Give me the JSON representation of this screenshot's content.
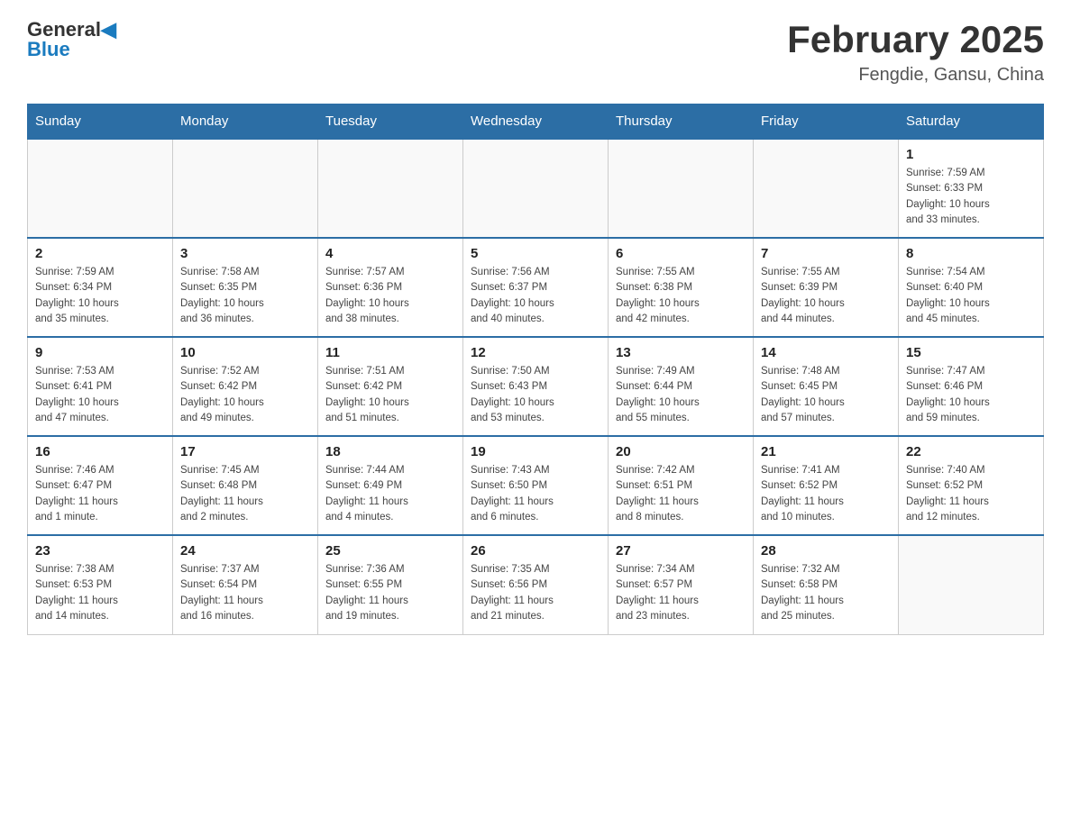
{
  "header": {
    "logo_general": "General",
    "logo_blue": "Blue",
    "month_title": "February 2025",
    "location": "Fengdie, Gansu, China"
  },
  "days_of_week": [
    "Sunday",
    "Monday",
    "Tuesday",
    "Wednesday",
    "Thursday",
    "Friday",
    "Saturday"
  ],
  "weeks": [
    {
      "days": [
        {
          "num": "",
          "info": ""
        },
        {
          "num": "",
          "info": ""
        },
        {
          "num": "",
          "info": ""
        },
        {
          "num": "",
          "info": ""
        },
        {
          "num": "",
          "info": ""
        },
        {
          "num": "",
          "info": ""
        },
        {
          "num": "1",
          "info": "Sunrise: 7:59 AM\nSunset: 6:33 PM\nDaylight: 10 hours\nand 33 minutes."
        }
      ]
    },
    {
      "days": [
        {
          "num": "2",
          "info": "Sunrise: 7:59 AM\nSunset: 6:34 PM\nDaylight: 10 hours\nand 35 minutes."
        },
        {
          "num": "3",
          "info": "Sunrise: 7:58 AM\nSunset: 6:35 PM\nDaylight: 10 hours\nand 36 minutes."
        },
        {
          "num": "4",
          "info": "Sunrise: 7:57 AM\nSunset: 6:36 PM\nDaylight: 10 hours\nand 38 minutes."
        },
        {
          "num": "5",
          "info": "Sunrise: 7:56 AM\nSunset: 6:37 PM\nDaylight: 10 hours\nand 40 minutes."
        },
        {
          "num": "6",
          "info": "Sunrise: 7:55 AM\nSunset: 6:38 PM\nDaylight: 10 hours\nand 42 minutes."
        },
        {
          "num": "7",
          "info": "Sunrise: 7:55 AM\nSunset: 6:39 PM\nDaylight: 10 hours\nand 44 minutes."
        },
        {
          "num": "8",
          "info": "Sunrise: 7:54 AM\nSunset: 6:40 PM\nDaylight: 10 hours\nand 45 minutes."
        }
      ]
    },
    {
      "days": [
        {
          "num": "9",
          "info": "Sunrise: 7:53 AM\nSunset: 6:41 PM\nDaylight: 10 hours\nand 47 minutes."
        },
        {
          "num": "10",
          "info": "Sunrise: 7:52 AM\nSunset: 6:42 PM\nDaylight: 10 hours\nand 49 minutes."
        },
        {
          "num": "11",
          "info": "Sunrise: 7:51 AM\nSunset: 6:42 PM\nDaylight: 10 hours\nand 51 minutes."
        },
        {
          "num": "12",
          "info": "Sunrise: 7:50 AM\nSunset: 6:43 PM\nDaylight: 10 hours\nand 53 minutes."
        },
        {
          "num": "13",
          "info": "Sunrise: 7:49 AM\nSunset: 6:44 PM\nDaylight: 10 hours\nand 55 minutes."
        },
        {
          "num": "14",
          "info": "Sunrise: 7:48 AM\nSunset: 6:45 PM\nDaylight: 10 hours\nand 57 minutes."
        },
        {
          "num": "15",
          "info": "Sunrise: 7:47 AM\nSunset: 6:46 PM\nDaylight: 10 hours\nand 59 minutes."
        }
      ]
    },
    {
      "days": [
        {
          "num": "16",
          "info": "Sunrise: 7:46 AM\nSunset: 6:47 PM\nDaylight: 11 hours\nand 1 minute."
        },
        {
          "num": "17",
          "info": "Sunrise: 7:45 AM\nSunset: 6:48 PM\nDaylight: 11 hours\nand 2 minutes."
        },
        {
          "num": "18",
          "info": "Sunrise: 7:44 AM\nSunset: 6:49 PM\nDaylight: 11 hours\nand 4 minutes."
        },
        {
          "num": "19",
          "info": "Sunrise: 7:43 AM\nSunset: 6:50 PM\nDaylight: 11 hours\nand 6 minutes."
        },
        {
          "num": "20",
          "info": "Sunrise: 7:42 AM\nSunset: 6:51 PM\nDaylight: 11 hours\nand 8 minutes."
        },
        {
          "num": "21",
          "info": "Sunrise: 7:41 AM\nSunset: 6:52 PM\nDaylight: 11 hours\nand 10 minutes."
        },
        {
          "num": "22",
          "info": "Sunrise: 7:40 AM\nSunset: 6:52 PM\nDaylight: 11 hours\nand 12 minutes."
        }
      ]
    },
    {
      "days": [
        {
          "num": "23",
          "info": "Sunrise: 7:38 AM\nSunset: 6:53 PM\nDaylight: 11 hours\nand 14 minutes."
        },
        {
          "num": "24",
          "info": "Sunrise: 7:37 AM\nSunset: 6:54 PM\nDaylight: 11 hours\nand 16 minutes."
        },
        {
          "num": "25",
          "info": "Sunrise: 7:36 AM\nSunset: 6:55 PM\nDaylight: 11 hours\nand 19 minutes."
        },
        {
          "num": "26",
          "info": "Sunrise: 7:35 AM\nSunset: 6:56 PM\nDaylight: 11 hours\nand 21 minutes."
        },
        {
          "num": "27",
          "info": "Sunrise: 7:34 AM\nSunset: 6:57 PM\nDaylight: 11 hours\nand 23 minutes."
        },
        {
          "num": "28",
          "info": "Sunrise: 7:32 AM\nSunset: 6:58 PM\nDaylight: 11 hours\nand 25 minutes."
        },
        {
          "num": "",
          "info": ""
        }
      ]
    }
  ]
}
